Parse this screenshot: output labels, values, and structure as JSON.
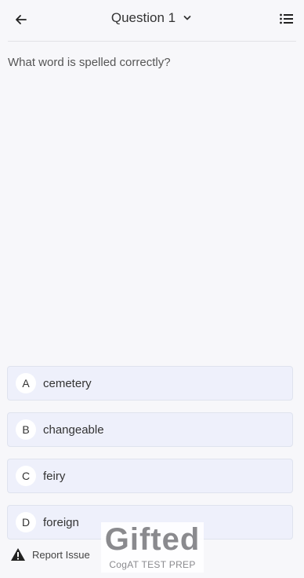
{
  "header": {
    "title": "Question 1"
  },
  "question": {
    "text": "What word is spelled correctly?"
  },
  "options": [
    {
      "letter": "A",
      "text": "cemetery"
    },
    {
      "letter": "B",
      "text": "changeable"
    },
    {
      "letter": "C",
      "text": "feiry"
    },
    {
      "letter": "D",
      "text": "foreign"
    }
  ],
  "footer": {
    "report_label": "Report Issue"
  },
  "logo": {
    "word": "Gifted",
    "subtitle": "CogAT TEST PREP"
  },
  "colors": {
    "background": "#f7f7fa",
    "option_bg": "#eef0fb",
    "option_border": "#dfe3ee"
  }
}
